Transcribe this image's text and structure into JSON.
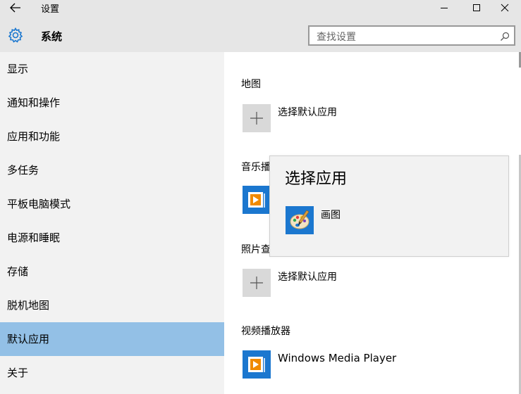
{
  "window": {
    "title": "设置",
    "controls": [
      "minimize-icon",
      "maximize-icon",
      "close-icon"
    ]
  },
  "header": {
    "icon": "gear-icon",
    "title": "系统",
    "search_placeholder": "查找设置"
  },
  "sidebar": {
    "items": [
      {
        "label": "显示",
        "selected": false
      },
      {
        "label": "通知和操作",
        "selected": false
      },
      {
        "label": "应用和功能",
        "selected": false
      },
      {
        "label": "多任务",
        "selected": false
      },
      {
        "label": "平板电脑模式",
        "selected": false
      },
      {
        "label": "电源和睡眠",
        "selected": false
      },
      {
        "label": "存储",
        "selected": false
      },
      {
        "label": "脱机地图",
        "selected": false
      },
      {
        "label": "默认应用",
        "selected": true
      },
      {
        "label": "关于",
        "selected": false
      }
    ]
  },
  "main": {
    "sections": [
      {
        "label": "地图",
        "app": "选择默认应用",
        "icon": "plus-icon"
      },
      {
        "label": "音乐播",
        "app": "",
        "icon": "windows-media-player-icon"
      },
      {
        "label": "照片查",
        "app": "选择默认应用",
        "icon": "plus-icon"
      },
      {
        "label": "视频播放器",
        "app": "Windows Media Player",
        "icon": "windows-media-player-icon"
      }
    ]
  },
  "popup": {
    "title": "选择应用",
    "apps": [
      {
        "label": "画图",
        "icon": "paint-icon"
      }
    ]
  },
  "colors": {
    "chrome": "#e6e6e6",
    "sidebar": "#f2f2f2",
    "selected": "#93c0e6",
    "app_tile": "#1b77cf",
    "plus_tile": "#d9d9d9"
  }
}
